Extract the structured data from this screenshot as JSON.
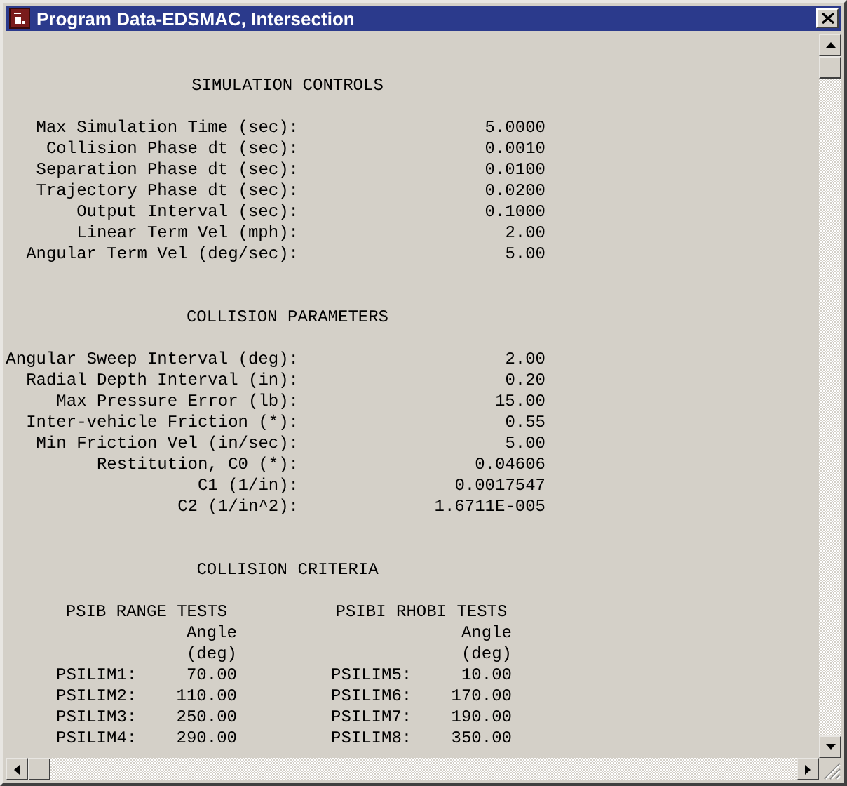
{
  "window": {
    "title": "Program Data-EDSMAC, Intersection"
  },
  "sections": [
    {
      "title": "SIMULATION CONTROLS",
      "rows": [
        {
          "label": "Max Simulation Time (sec):",
          "value": "5.0000"
        },
        {
          "label": "Collision Phase dt (sec):",
          "value": "0.0010"
        },
        {
          "label": "Separation Phase dt (sec):",
          "value": "0.0100"
        },
        {
          "label": "Trajectory Phase dt (sec):",
          "value": "0.0200"
        },
        {
          "label": "Output Interval (sec):",
          "value": "0.1000"
        },
        {
          "label": "Linear Term Vel (mph):",
          "value": "2.00"
        },
        {
          "label": "Angular Term Vel (deg/sec):",
          "value": "5.00"
        }
      ]
    },
    {
      "title": "COLLISION PARAMETERS",
      "rows": [
        {
          "label": "Angular Sweep Interval (deg):",
          "value": "2.00"
        },
        {
          "label": "Radial Depth Interval (in):",
          "value": "0.20"
        },
        {
          "label": "Max Pressure Error (lb):",
          "value": "15.00"
        },
        {
          "label": "Inter-vehicle Friction (*):",
          "value": "0.55"
        },
        {
          "label": "Min Friction Vel (in/sec):",
          "value": "5.00"
        },
        {
          "label": "Restitution, C0 (*):",
          "value": "0.04606"
        },
        {
          "label": "C1 (1/in):",
          "value": "0.0017547"
        },
        {
          "label": "C2 (1/in^2):",
          "value": "1.6711E-005"
        }
      ]
    }
  ],
  "collision_criteria": {
    "title": "COLLISION CRITERIA",
    "tables": [
      {
        "title": "PSIB RANGE TESTS",
        "column_header": [
          "Angle",
          "(deg)"
        ],
        "rows": [
          {
            "label": "PSILIM1:",
            "value": "70.00"
          },
          {
            "label": "PSILIM2:",
            "value": "110.00"
          },
          {
            "label": "PSILIM3:",
            "value": "250.00"
          },
          {
            "label": "PSILIM4:",
            "value": "290.00"
          }
        ]
      },
      {
        "title": "PSIBI RHOBI TESTS",
        "column_header": [
          "Angle",
          "(deg)"
        ],
        "rows": [
          {
            "label": "PSILIM5:",
            "value": "10.00"
          },
          {
            "label": "PSILIM6:",
            "value": "170.00"
          },
          {
            "label": "PSILIM7:",
            "value": "190.00"
          },
          {
            "label": "PSILIM8:",
            "value": "350.00"
          }
        ]
      }
    ]
  }
}
